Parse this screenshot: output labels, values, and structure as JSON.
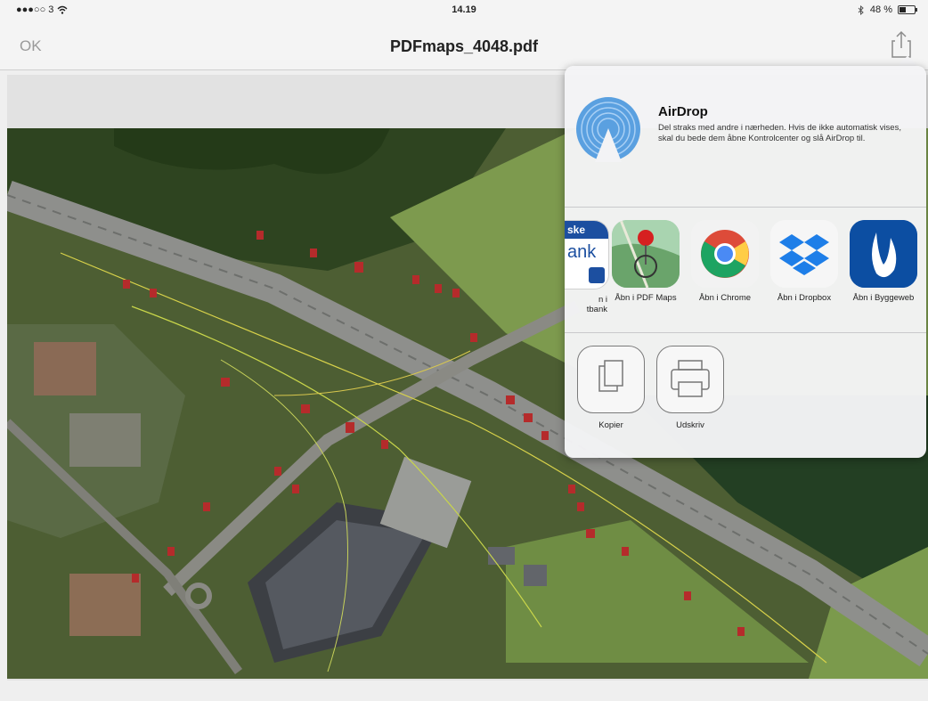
{
  "status_bar": {
    "carrier": "●●●○○ 3",
    "time": "14.19",
    "battery": "48 %"
  },
  "nav": {
    "back_label": "OK",
    "title": "PDFmaps_4048.pdf"
  },
  "share_sheet": {
    "airdrop": {
      "title": "AirDrop",
      "description": "Del straks med andre i nærheden. Hvis de ikke automatisk vises, skal du bede dem åbne Kontrolcenter og slå AirDrop til."
    },
    "apps": [
      {
        "label": "n i\ntbank",
        "icon": "bank-app-icon"
      },
      {
        "label": "Åbn i PDF Maps",
        "icon": "pdf-maps-icon"
      },
      {
        "label": "Åbn i Chrome",
        "icon": "chrome-icon"
      },
      {
        "label": "Åbn i Dropbox",
        "icon": "dropbox-icon"
      },
      {
        "label": "Åbn i Byggeweb",
        "icon": "byggeweb-icon"
      }
    ],
    "actions": [
      {
        "label": "Kopier",
        "icon": "copy-icon"
      },
      {
        "label": "Udskriv",
        "icon": "print-icon"
      }
    ],
    "bank_icon_text_top": "ske",
    "bank_icon_text_mid": "ank"
  },
  "colors": {
    "airdrop_blue": "#5aa0e0",
    "dropbox_blue": "#1e7ee8",
    "byggeweb_blue": "#0c4ea2"
  }
}
